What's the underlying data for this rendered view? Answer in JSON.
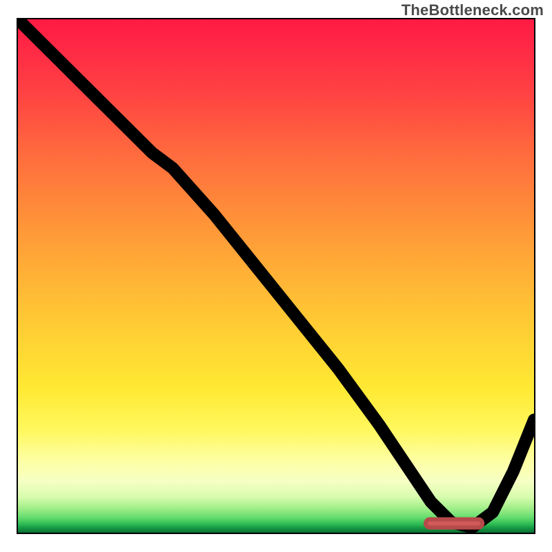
{
  "watermark": "TheBottleneck.com",
  "chart_data": {
    "type": "line",
    "title": "",
    "xlabel": "",
    "ylabel": "",
    "xlim": [
      0,
      100
    ],
    "ylim": [
      0,
      100
    ],
    "grid": false,
    "legend": false,
    "series": [
      {
        "name": "bottleneck-curve",
        "x": [
          0,
          6,
          12,
          18,
          22,
          26,
          30,
          38,
          46,
          54,
          62,
          70,
          76,
          80,
          84,
          88,
          92,
          96,
          100
        ],
        "y": [
          100,
          94,
          88,
          82,
          78,
          74,
          71,
          62,
          52,
          42,
          32,
          21,
          12,
          6,
          2,
          1,
          4,
          12,
          22
        ]
      }
    ],
    "annotations": [
      {
        "name": "optimal-range-marker",
        "kind": "hbar",
        "x0": 79,
        "x1": 90,
        "y": 1.8,
        "thickness": 1.6,
        "color": "#d35a5a"
      }
    ],
    "background_gradient": {
      "direction": "vertical",
      "stops": [
        {
          "pos": 0.0,
          "color": "#ff1a44"
        },
        {
          "pos": 0.5,
          "color": "#ffb236"
        },
        {
          "pos": 0.8,
          "color": "#fff85e"
        },
        {
          "pos": 0.95,
          "color": "#a8f08e"
        },
        {
          "pos": 1.0,
          "color": "#0c6e33"
        }
      ]
    }
  }
}
